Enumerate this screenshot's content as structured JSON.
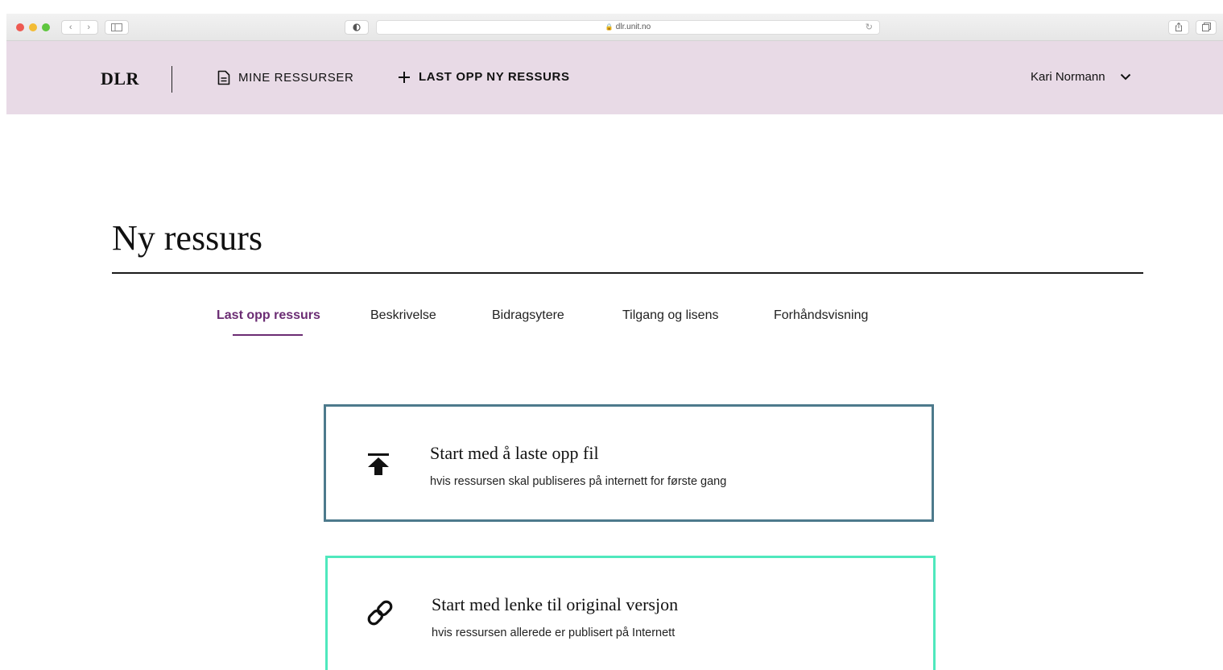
{
  "browser": {
    "url": "dlr.unit.no",
    "nav_back": "‹",
    "nav_forward": "›"
  },
  "header": {
    "logo": "DLR",
    "my_resources_label": "MINE RESSURSER",
    "upload_new_label": "LAST OPP NY RESSURS",
    "user_name": "Kari Normann"
  },
  "main": {
    "title": "Ny ressurs",
    "steps": [
      {
        "label": "Last opp ressurs",
        "active": true
      },
      {
        "label": "Beskrivelse",
        "active": false
      },
      {
        "label": "Bidragsytere",
        "active": false
      },
      {
        "label": "Tilgang og lisens",
        "active": false
      },
      {
        "label": "Forhåndsvisning",
        "active": false
      }
    ],
    "options": [
      {
        "icon": "upload-icon",
        "title": "Start med å laste opp fil",
        "subtitle": "hvis ressursen skal publiseres på internett for første gang",
        "border_color": "#4d7a8c"
      },
      {
        "icon": "link-icon",
        "title": "Start med lenke til original versjon",
        "subtitle": "hvis ressursen allerede er publisert på Internett",
        "border_color": "#4fe8bd"
      }
    ]
  },
  "colors": {
    "header_bg": "#e8dae6",
    "accent": "#6b2c73"
  }
}
